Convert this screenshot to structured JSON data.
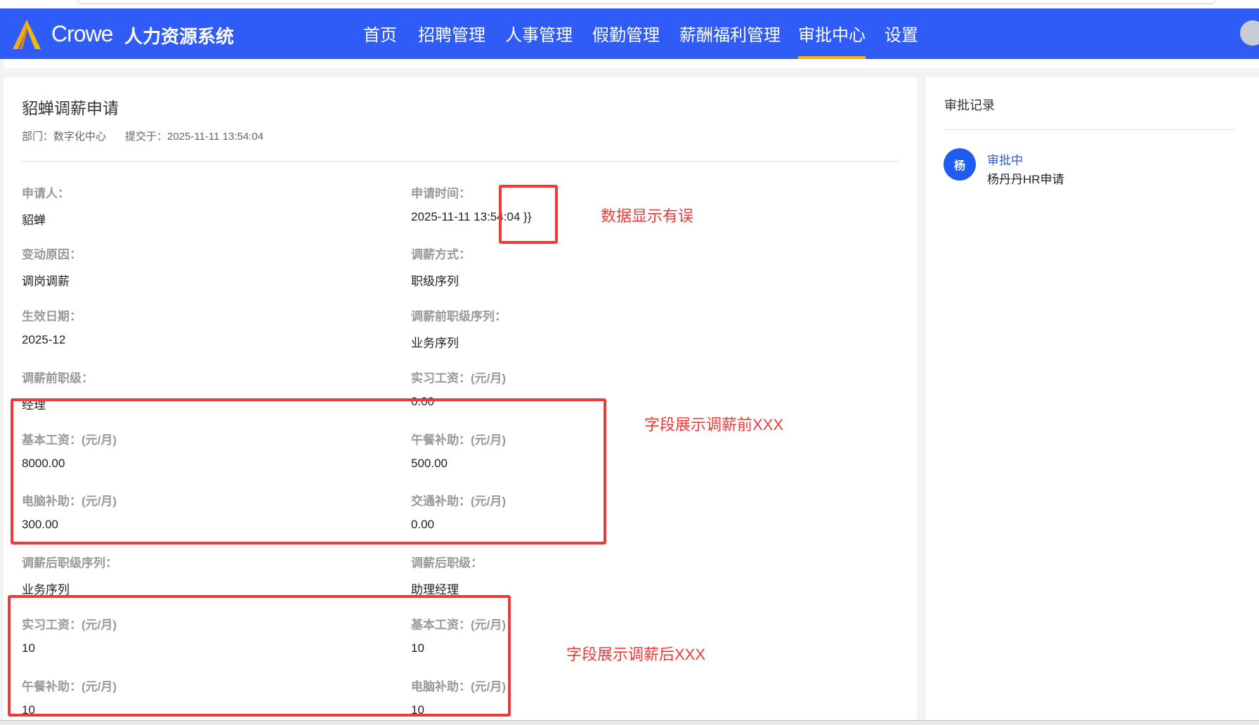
{
  "header": {
    "brand": "Crowe",
    "system_name": "人力资源系统",
    "nav": [
      "首页",
      "招聘管理",
      "人事管理",
      "假勤管理",
      "薪酬福利管理",
      "审批中心",
      "设置"
    ],
    "active_nav": "审批中心"
  },
  "detail": {
    "title": "貂蝉调薪申请",
    "department": "部门：数字化中心",
    "submitted": "提交于：2025-11-11 13:54:04",
    "fields": [
      {
        "label": "申请人：",
        "value": "貂蝉"
      },
      {
        "label": "申请时间：",
        "value": "2025-11-11 13:54:04 }}"
      },
      {
        "label": "变动原因：",
        "value": "调岗调薪"
      },
      {
        "label": "调薪方式：",
        "value": "职级序列"
      },
      {
        "label": "生效日期：",
        "value": "2025-12"
      },
      {
        "label": "调薪前职级序列：",
        "value": "业务序列"
      },
      {
        "label": "调薪前职级：",
        "value": "经理"
      },
      {
        "label": "实习工资：(元/月)",
        "value": "0.00"
      },
      {
        "label": "基本工资：(元/月)",
        "value": "8000.00"
      },
      {
        "label": "午餐补助：(元/月)",
        "value": "500.00"
      },
      {
        "label": "电脑补助：(元/月)",
        "value": "300.00"
      },
      {
        "label": "交通补助：(元/月)",
        "value": "0.00"
      },
      {
        "label": "调薪后职级序列：",
        "value": "业务序列"
      },
      {
        "label": "调薪后职级：",
        "value": "助理经理"
      },
      {
        "label": "实习工资：(元/月)",
        "value": "10"
      },
      {
        "label": "基本工资：(元/月)",
        "value": "10"
      },
      {
        "label": "午餐补助：(元/月)",
        "value": "10"
      },
      {
        "label": "电脑补助：(元/月)",
        "value": "10"
      }
    ]
  },
  "annotations": [
    "数据显示有误",
    "字段展示调薪前XXX",
    "字段展示调薪后XXX"
  ],
  "approval": {
    "title": "审批记录",
    "avatar_char": "杨",
    "status": "审批中",
    "description": "杨丹丹HR申请"
  },
  "colors": {
    "header": "#2f5cf6",
    "active_underline": "#f7b900",
    "annotation": "#f03a3a",
    "link": "#1f5cf0"
  }
}
